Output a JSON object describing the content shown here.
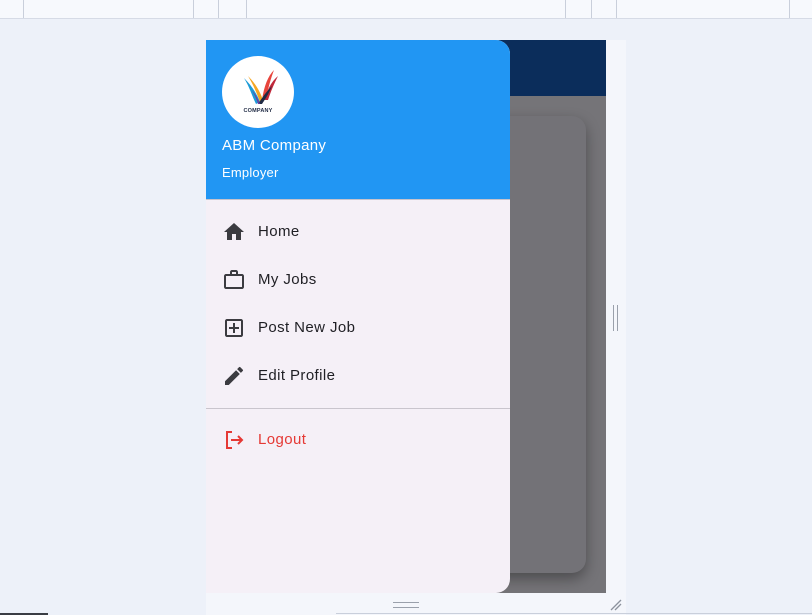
{
  "drawer": {
    "company_name": "ABM Company",
    "role": "Employer",
    "logo_text": "COMPANY",
    "items": [
      {
        "label": "Home",
        "icon": "home-icon"
      },
      {
        "label": "My Jobs",
        "icon": "briefcase-icon"
      },
      {
        "label": "Post New Job",
        "icon": "add-box-icon"
      },
      {
        "label": "Edit Profile",
        "icon": "edit-pencil-icon"
      }
    ],
    "logout": {
      "label": "Logout",
      "icon": "logout-icon"
    }
  },
  "colors": {
    "header_bg": "#2196f3",
    "app_bar": "#0b2d5b",
    "drawer_bg": "#f5f0f7",
    "logout": "#e53935",
    "scrim": "#757478"
  }
}
